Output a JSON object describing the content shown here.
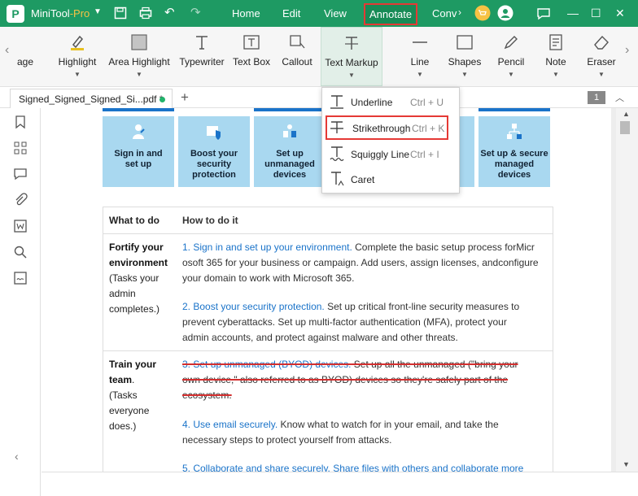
{
  "app": {
    "name": "MiniTool",
    "suffix": "-Pro",
    "logo_letter": "P"
  },
  "menu": [
    "Home",
    "Edit",
    "View",
    "Annotate",
    "Conv"
  ],
  "colors": {
    "brand": "#1e9a63",
    "accent_red": "#e53935",
    "link_blue": "#1a73c9"
  },
  "ribbon": {
    "partial_left": "age",
    "tools": [
      "Highlight",
      "Area Highlight",
      "Typewriter",
      "Text Box",
      "Callout",
      "Text Markup",
      "Line",
      "Shapes",
      "Pencil",
      "Note",
      "Eraser"
    ]
  },
  "tab": {
    "name": "Signed_Signed_Signed_Si...pdf *",
    "add": "+",
    "page_number": "1"
  },
  "dropdown": [
    {
      "label": "Underline",
      "shortcut": "Ctrl + U"
    },
    {
      "label": "Strikethrough",
      "shortcut": "Ctrl + K"
    },
    {
      "label": "Squiggly Line",
      "shortcut": "Ctrl + I"
    },
    {
      "label": "Caret",
      "shortcut": ""
    }
  ],
  "tiles": [
    {
      "line1": "Sign in and",
      "line2": "set up",
      "line3": ""
    },
    {
      "line1": "Boost your",
      "line2": "security",
      "line3": "protection"
    },
    {
      "line1": "Set up",
      "line2": "unmanaged",
      "line3": "devices"
    },
    {
      "line1": "&",
      "line2": "ely",
      "line3": ""
    },
    {
      "line1": "Set up & secure",
      "line2": "managed",
      "line3": "devices"
    }
  ],
  "table": {
    "header": {
      "col1": "What to do",
      "col2": "How to do it"
    },
    "row1": {
      "c1_bold1": "Fortify your",
      "c1_bold2": "environment",
      "c1_l3": "(Tasks your",
      "c1_l4": "admin",
      "c1_l5": "completes.)",
      "p1_link": "1. Sign in and set up your environment.",
      "p1_l1": " Complete the basic setup process forMicr",
      "p1_l2": "osoft 365 for your business or campaign. Add users, assign licenses, andconfigure",
      "p1_l3": "your domain to work with Microsoft 365.",
      "p2_link": "2. Boost your security protection.",
      "p2_l1": " Set up critical front-line security measures to",
      "p2_l2": "prevent cyberattacks. Set up multi-factor authentication (MFA), protect your",
      "p2_l3": "admin accounts, and protect against malware and other threats."
    },
    "row2": {
      "c1_bold1": "Train your",
      "c1_bold2": "team",
      "c1_dot": ".",
      "c1_l3": "(Tasks",
      "c1_l4": "everyone",
      "c1_l5": "does.)",
      "p3_link": "3. Set up unmanaged (BYOD) devices.",
      "p3_l1": " Set up all the unmanaged (\"bring your",
      "p3_l2": "own device,\" also referred to as BYOD) devices so they're safely part of the",
      "p3_l3": "ecosystem.",
      "p4_link": "4. Use email securely.",
      "p4_l1": " Know what to watch for in your email, and take the",
      "p4_l2": "necessary steps to protect yourself from attacks.",
      "p5_partial": "5. Collaborate and share securely. Share files with others and collaborate more"
    }
  }
}
